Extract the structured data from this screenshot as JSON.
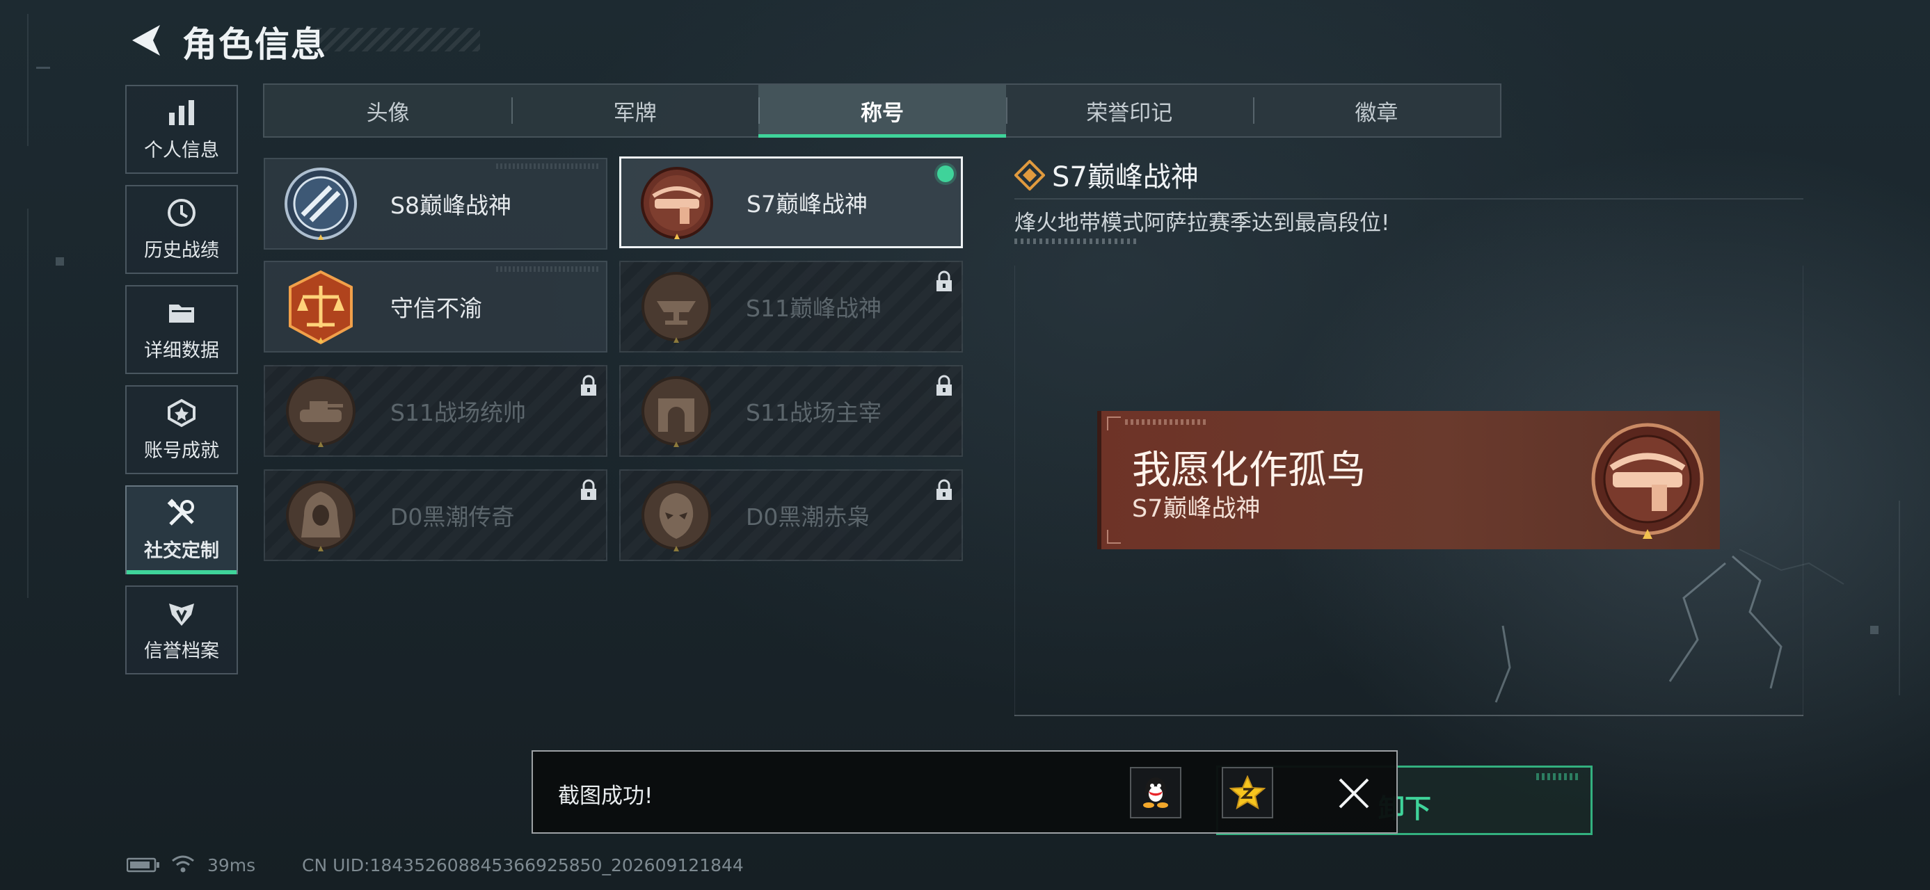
{
  "header": {
    "title": "角色信息"
  },
  "sidebar": {
    "items": [
      {
        "label": "个人信息",
        "icon": "bar-chart-icon"
      },
      {
        "label": "历史战绩",
        "icon": "clock-icon"
      },
      {
        "label": "详细数据",
        "icon": "folder-icon"
      },
      {
        "label": "账号成就",
        "icon": "achievement-icon"
      },
      {
        "label": "社交定制",
        "icon": "tools-icon",
        "active": true
      },
      {
        "label": "信誉档案",
        "icon": "shield-wings-icon"
      }
    ]
  },
  "tabs": [
    {
      "label": "头像"
    },
    {
      "label": "军牌"
    },
    {
      "label": "称号",
      "active": true
    },
    {
      "label": "荣誉印记"
    },
    {
      "label": "徽章"
    }
  ],
  "titles": [
    {
      "name": "S8巅峰战神",
      "locked": false
    },
    {
      "name": "S7巅峰战神",
      "locked": false,
      "selected": true,
      "equipped": true
    },
    {
      "name": "守信不渝",
      "locked": false
    },
    {
      "name": "S11巅峰战神",
      "locked": true
    },
    {
      "name": "S11战场统帅",
      "locked": true
    },
    {
      "name": "S11战场主宰",
      "locked": true
    },
    {
      "name": "D0黑潮传奇",
      "locked": true
    },
    {
      "name": "D0黑潮赤枭",
      "locked": true
    }
  ],
  "detail": {
    "title": "S7巅峰战神",
    "description": "烽火地带模式阿萨拉赛季达到最高段位!",
    "preview": {
      "player_name": "我愿化作孤鸟",
      "title_name": "S7巅峰战神"
    }
  },
  "action": {
    "unequip_label": "卸下"
  },
  "toast": {
    "message": "截图成功!",
    "share_icons": [
      "qq-icon",
      "qzone-icon"
    ]
  },
  "status_bar": {
    "ping": "39ms",
    "uid": "CN UID:184352608845366925850_202609121844"
  },
  "colors": {
    "accent": "#3fd39a",
    "banner": "#6e3327",
    "text": "#e6eaed"
  }
}
